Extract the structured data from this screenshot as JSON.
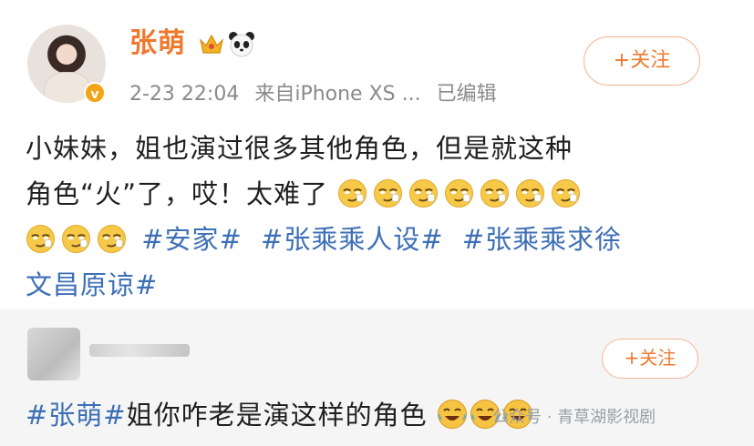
{
  "post": {
    "username": "张萌",
    "timestamp": "2-23 22:04",
    "source": "来自iPhone XS ...",
    "edited": "已编辑",
    "follow_label": "+关注",
    "text_line1": "小妹妹，姐也演过很多其他角色，但是就这种",
    "text_line2": "角色“火”了，哎！太难了",
    "tags": [
      "#安家#",
      "#张乘乘人设#",
      "#张乘乘求徐"
    ],
    "tag_cont": "文昌原谅#",
    "emojis_line2": 7,
    "emojis_line3": 3
  },
  "comment": {
    "follow_label": "+关注",
    "tag": "#张萌#",
    "text": "姐你咋老是演这样的角色"
  },
  "watermark": "公众号 · 青草湖影视剧",
  "colors": {
    "brand_orange": "#f0792f",
    "hashtag_blue": "#3d6fb6",
    "meta_gray": "#8a8a8a"
  },
  "icons": [
    "crown-icon",
    "panda-icon",
    "verified-badge-icon",
    "doge-emoji",
    "laugh-cry-emoji"
  ]
}
